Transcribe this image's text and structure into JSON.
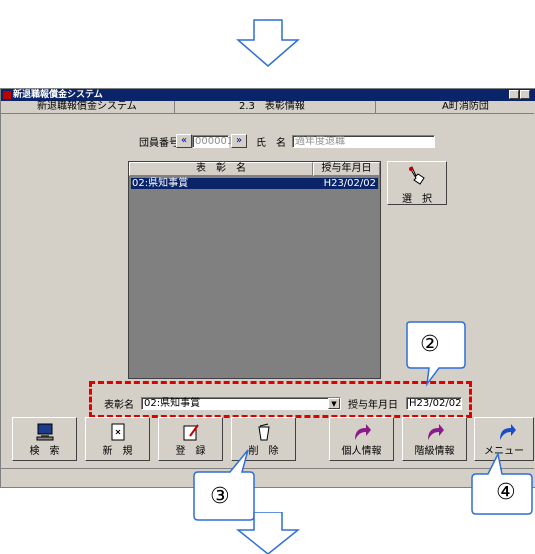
{
  "window": {
    "title": "新退職報償金システム",
    "header_left": "新退職報償金システム",
    "header_center": "2.3　表彰情報",
    "header_right": "A町消防団"
  },
  "member": {
    "number_label": "団員番号",
    "number_value": "000001",
    "name_label": "氏　名",
    "name_value": "過年度退職"
  },
  "list": {
    "columns": [
      "表　彰　名",
      "授与年月日"
    ],
    "rows": [
      {
        "name": "02:県知事賞",
        "date": "H23/02/02"
      }
    ]
  },
  "select_button": "選　択",
  "form": {
    "award_label": "表彰名",
    "award_value": "02:県知事賞",
    "date_label": "授与年月日",
    "date_value": "H23/02/02"
  },
  "toolbar": {
    "search": "検　索",
    "new": "新　規",
    "register": "登　録",
    "delete": "削　除",
    "personal": "個人情報",
    "rank": "階級情報",
    "menu": "メニュー"
  },
  "callouts": {
    "c2": "②",
    "c3": "③",
    "c4": "④"
  },
  "colors": {
    "highlight_dash": "#e00000",
    "callout_border": "#2f6fd6",
    "selection": "#0a246a"
  }
}
